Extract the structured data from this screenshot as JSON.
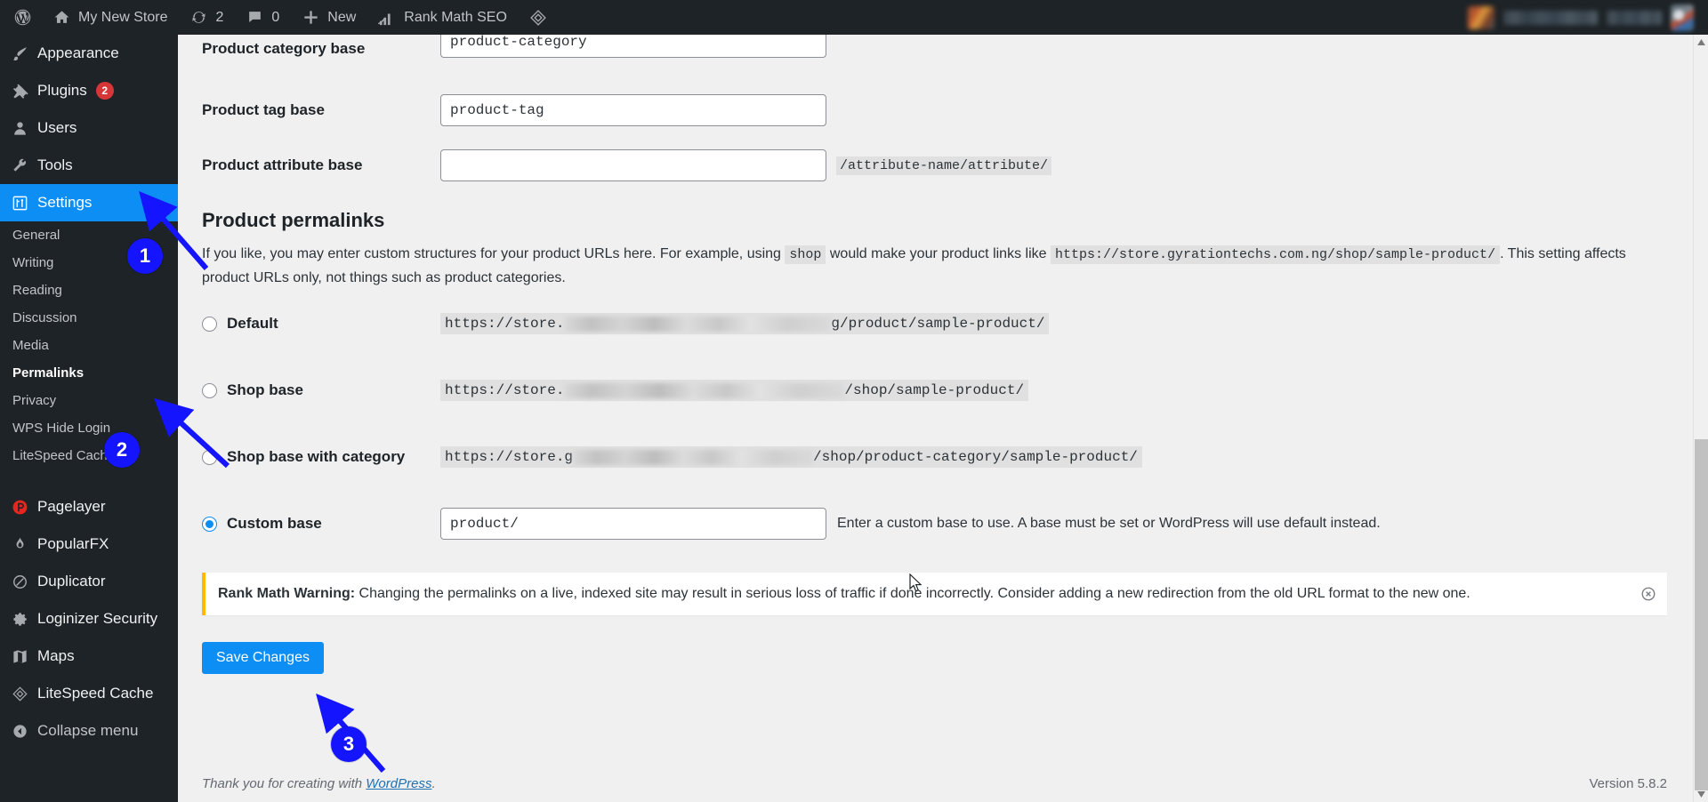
{
  "adminbar": {
    "wp_logo": "wordpress-logo-icon",
    "site_name": "My New Store",
    "updates_count": "2",
    "comments_count": "0",
    "new_label": "New",
    "rankmath_label": "Rank Math SEO",
    "litespeed_label": "litespeed-icon"
  },
  "sidebar": {
    "top_items": [
      {
        "label": "Appearance",
        "icon": "appearance-brush-icon",
        "badge": ""
      },
      {
        "label": "Plugins",
        "icon": "plugins-plug-icon",
        "badge": "2"
      },
      {
        "label": "Users",
        "icon": "users-icon",
        "badge": ""
      },
      {
        "label": "Tools",
        "icon": "tools-wrench-icon",
        "badge": ""
      },
      {
        "label": "Settings",
        "icon": "settings-sliders-icon",
        "badge": ""
      }
    ],
    "settings_submenu": [
      {
        "label": "General",
        "current": false
      },
      {
        "label": "Writing",
        "current": false
      },
      {
        "label": "Reading",
        "current": false
      },
      {
        "label": "Discussion",
        "current": false
      },
      {
        "label": "Media",
        "current": false
      },
      {
        "label": "Permalinks",
        "current": true
      },
      {
        "label": "Privacy",
        "current": false
      },
      {
        "label": "WPS Hide Login",
        "current": false
      },
      {
        "label": "LiteSpeed Cache",
        "current": false
      }
    ],
    "plugin_items": [
      {
        "label": "Pagelayer",
        "icon": "pagelayer-icon"
      },
      {
        "label": "PopularFX",
        "icon": "popularfx-icon"
      },
      {
        "label": "Duplicator",
        "icon": "duplicator-icon"
      },
      {
        "label": "Loginizer Security",
        "icon": "loginizer-gear-icon"
      },
      {
        "label": "Maps",
        "icon": "maps-icon"
      },
      {
        "label": "LiteSpeed Cache",
        "icon": "litespeed-diamond-icon"
      }
    ],
    "collapse_label": "Collapse menu"
  },
  "main": {
    "fields": [
      {
        "label": "Product category base",
        "value": "product-category",
        "suffix": ""
      },
      {
        "label": "Product tag base",
        "value": "product-tag",
        "suffix": ""
      },
      {
        "label": "Product attribute base",
        "value": "",
        "suffix": "/attribute-name/attribute/"
      }
    ],
    "section_title": "Product permalinks",
    "description": {
      "part1": "If you like, you may enter custom structures for your product URLs here. For example, using",
      "code1": "shop",
      "part2": "would make your product links like",
      "code2": "https://store.gyrationtechs.com.ng/shop/sample-product/",
      "part3": ". This setting affects product URLs only, not things such as product categories."
    },
    "permalink_options": [
      {
        "label": "Default",
        "selected": false,
        "url_prefix": "https://store.",
        "url_suffix": "g/product/sample-product/",
        "redacted_width": 300
      },
      {
        "label": "Shop base",
        "selected": false,
        "url_prefix": "https://store.",
        "url_suffix": "/shop/sample-product/",
        "redacted_width": 315
      },
      {
        "label": "Shop base with category",
        "selected": false,
        "url_prefix": "https://store.g",
        "url_suffix": "/shop/product-category/sample-product/",
        "redacted_width": 270
      }
    ],
    "custom_base": {
      "label": "Custom base",
      "selected": true,
      "value": "product/",
      "help": "Enter a custom base to use. A base must be set or WordPress will use default instead."
    },
    "notice": {
      "strong": "Rank Math Warning:",
      "text": " Changing the permalinks on a live, indexed site may result in serious loss of traffic if done incorrectly. Consider adding a new redirection from the old URL format to the new one.",
      "dismiss_icon": "dismiss-circle-x-icon"
    },
    "save_button": "Save Changes"
  },
  "footer": {
    "thanks_prefix": "Thank you for creating with ",
    "thanks_link": "WordPress",
    "thanks_suffix": ".",
    "version": "Version 5.8.2"
  },
  "annotations": {
    "badge1": "1",
    "badge2": "2",
    "badge3": "3",
    "color": "#1414ff"
  }
}
